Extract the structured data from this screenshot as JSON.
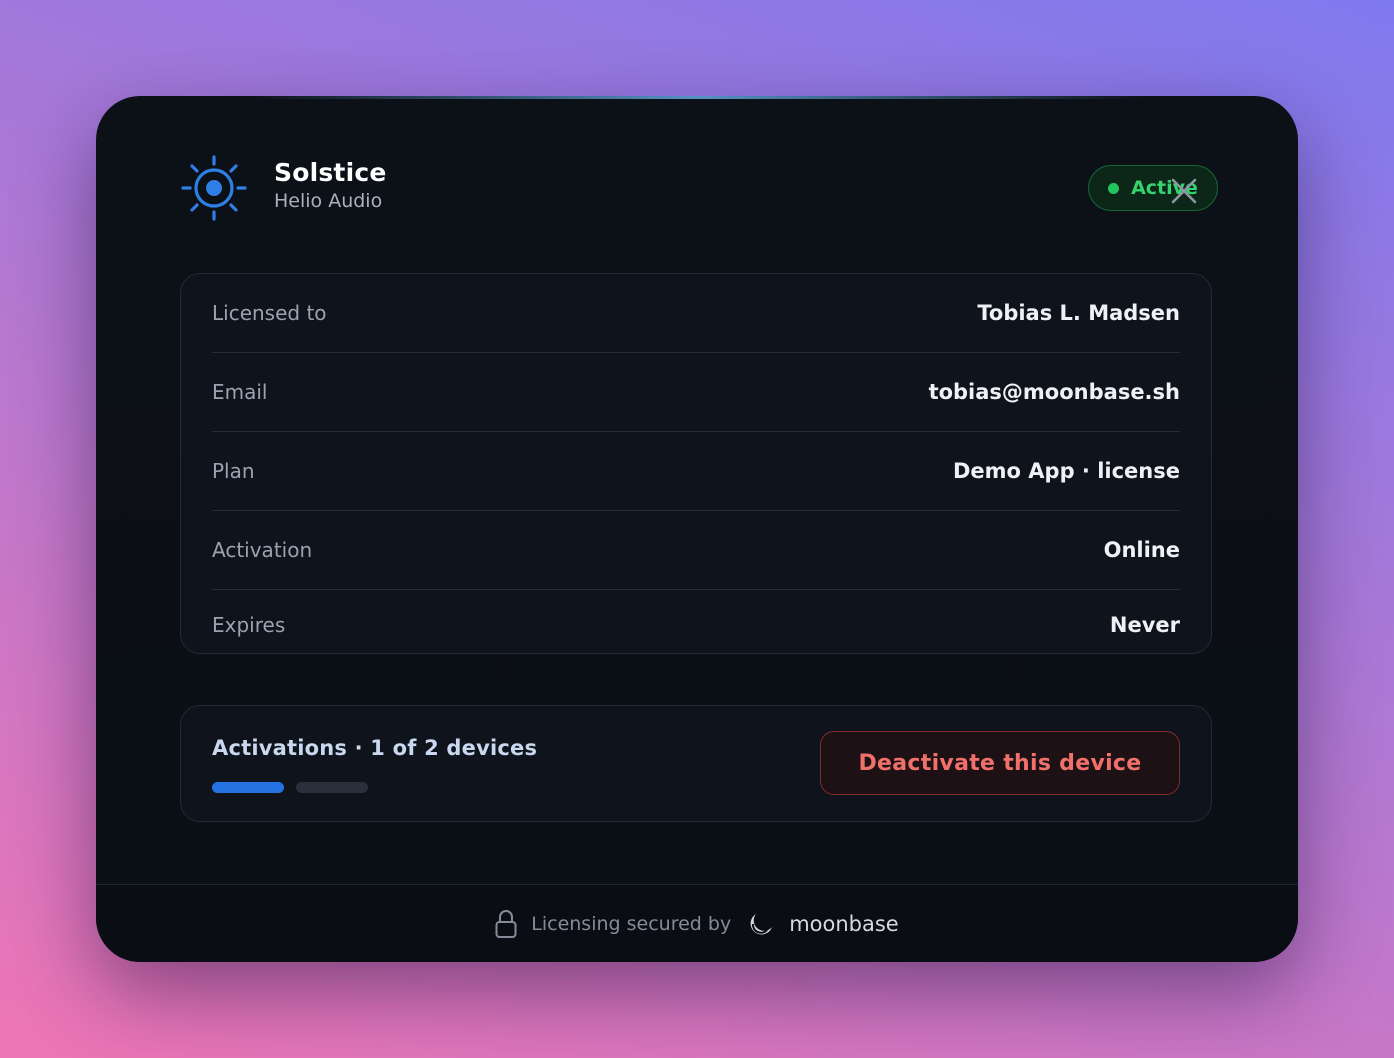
{
  "app": {
    "title": "Solstice",
    "subtitle": "Helio Audio"
  },
  "status": {
    "label": "Active",
    "color": "#22c55e"
  },
  "license": {
    "rows": [
      {
        "label": "Licensed to",
        "value": "Tobias L. Madsen"
      },
      {
        "label": "Email",
        "value": "tobias@moonbase.sh"
      },
      {
        "label": "Plan",
        "value": "Demo App · license"
      },
      {
        "label": "Activation",
        "value": "Online"
      },
      {
        "label": "Expires",
        "value": "Never"
      }
    ]
  },
  "activations": {
    "label": "Activations · 1 of 2 devices",
    "used": 1,
    "total": 2,
    "deactivate_label": "Deactivate this device"
  },
  "footer": {
    "text": "Licensing secured by",
    "brand": "moonbase"
  },
  "colors": {
    "accent": "#2573e1",
    "danger": "#f0706a"
  },
  "icons": [
    "sun-logo-icon",
    "close-icon",
    "lock-icon",
    "moonbase-logo-icon"
  ]
}
